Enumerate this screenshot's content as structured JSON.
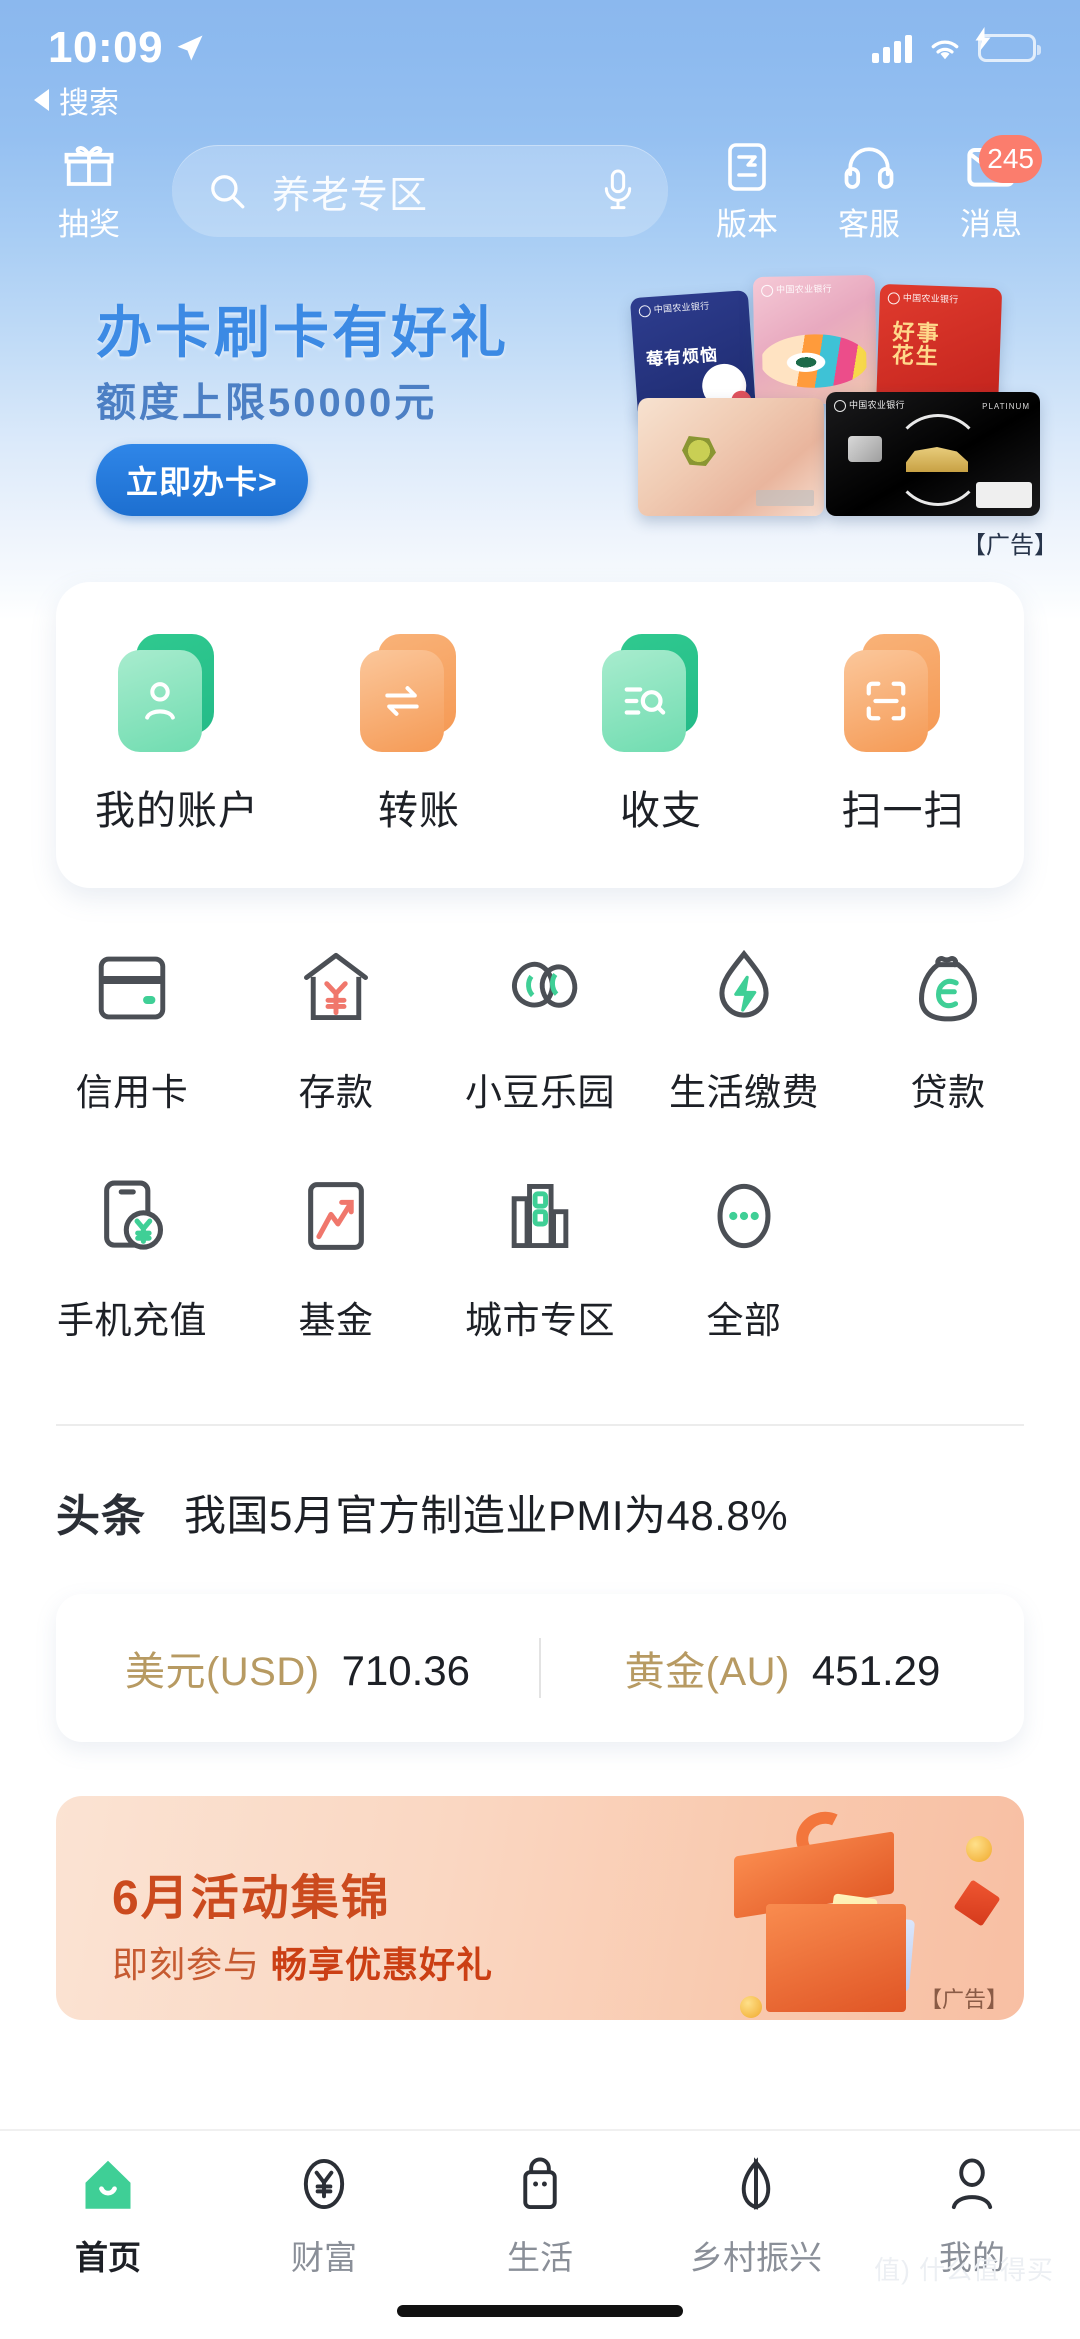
{
  "status_bar": {
    "time": "10:09",
    "location_icon": "location-arrow-icon",
    "signal_icon": "cellular-signal-icon",
    "wifi_icon": "wifi-icon",
    "battery_icon": "battery-charging-icon"
  },
  "back_row": {
    "label": "搜索",
    "icon": "back-triangle-icon"
  },
  "header": {
    "lottery": {
      "label": "抽奖",
      "icon": "gift-icon"
    },
    "search": {
      "placeholder": "养老专区",
      "search_icon": "search-icon",
      "mic_icon": "microphone-icon"
    },
    "version": {
      "label": "版本",
      "icon": "version-switch-icon"
    },
    "service": {
      "label": "客服",
      "icon": "headset-icon"
    },
    "messages": {
      "label": "消息",
      "icon": "envelope-icon",
      "badge": "245"
    }
  },
  "hero": {
    "title": "办卡刷卡有好礼",
    "subtitle": "额度上限50000元",
    "button": "立即办卡>",
    "ad_label": "【广告】"
  },
  "quick_actions": [
    {
      "label": "我的账户",
      "icon": "person-account-icon",
      "color": "green"
    },
    {
      "label": "转账",
      "icon": "transfer-arrows-icon",
      "color": "orange"
    },
    {
      "label": "收支",
      "icon": "income-expense-search-icon",
      "color": "green"
    },
    {
      "label": "扫一扫",
      "icon": "scan-qr-icon",
      "color": "orange"
    }
  ],
  "grid": {
    "row1": [
      {
        "label": "信用卡",
        "icon": "credit-card-icon"
      },
      {
        "label": "存款",
        "icon": "deposit-house-yuan-icon"
      },
      {
        "label": "小豆乐园",
        "icon": "bean-park-icon"
      },
      {
        "label": "生活缴费",
        "icon": "utility-payment-drop-icon"
      },
      {
        "label": "贷款",
        "icon": "loan-money-bag-icon"
      }
    ],
    "row2": [
      {
        "label": "手机充值",
        "icon": "phone-topup-icon"
      },
      {
        "label": "基金",
        "icon": "fund-chart-icon"
      },
      {
        "label": "城市专区",
        "icon": "city-zone-icon"
      },
      {
        "label": "全部",
        "icon": "more-dots-icon"
      }
    ]
  },
  "headline": {
    "tag": "头条",
    "text": "我国5月官方制造业PMI为48.8%"
  },
  "rates": [
    {
      "name": "美元(USD)",
      "value": "710.36"
    },
    {
      "name": "黄金(AU)",
      "value": "451.29"
    }
  ],
  "promo": {
    "title": "6月活动集锦",
    "subtitle_plain": "即刻参与 ",
    "subtitle_bold": "畅享优惠好礼",
    "ad_label": "【广告】"
  },
  "tabbar": [
    {
      "label": "首页",
      "icon": "home-icon",
      "active": true
    },
    {
      "label": "财富",
      "icon": "wealth-yuan-icon",
      "active": false
    },
    {
      "label": "生活",
      "icon": "life-bag-icon",
      "active": false
    },
    {
      "label": "乡村振兴",
      "icon": "rural-leaf-icon",
      "active": false
    },
    {
      "label": "我的",
      "icon": "profile-person-icon",
      "active": false
    }
  ],
  "watermark": "值) 什么值得买",
  "colors": {
    "brand_green": "#2fc98f",
    "brand_orange": "#f59a55",
    "header_blue": "#8bb8ee",
    "badge_red": "#fb7d6d",
    "gold": "#b79a62"
  }
}
